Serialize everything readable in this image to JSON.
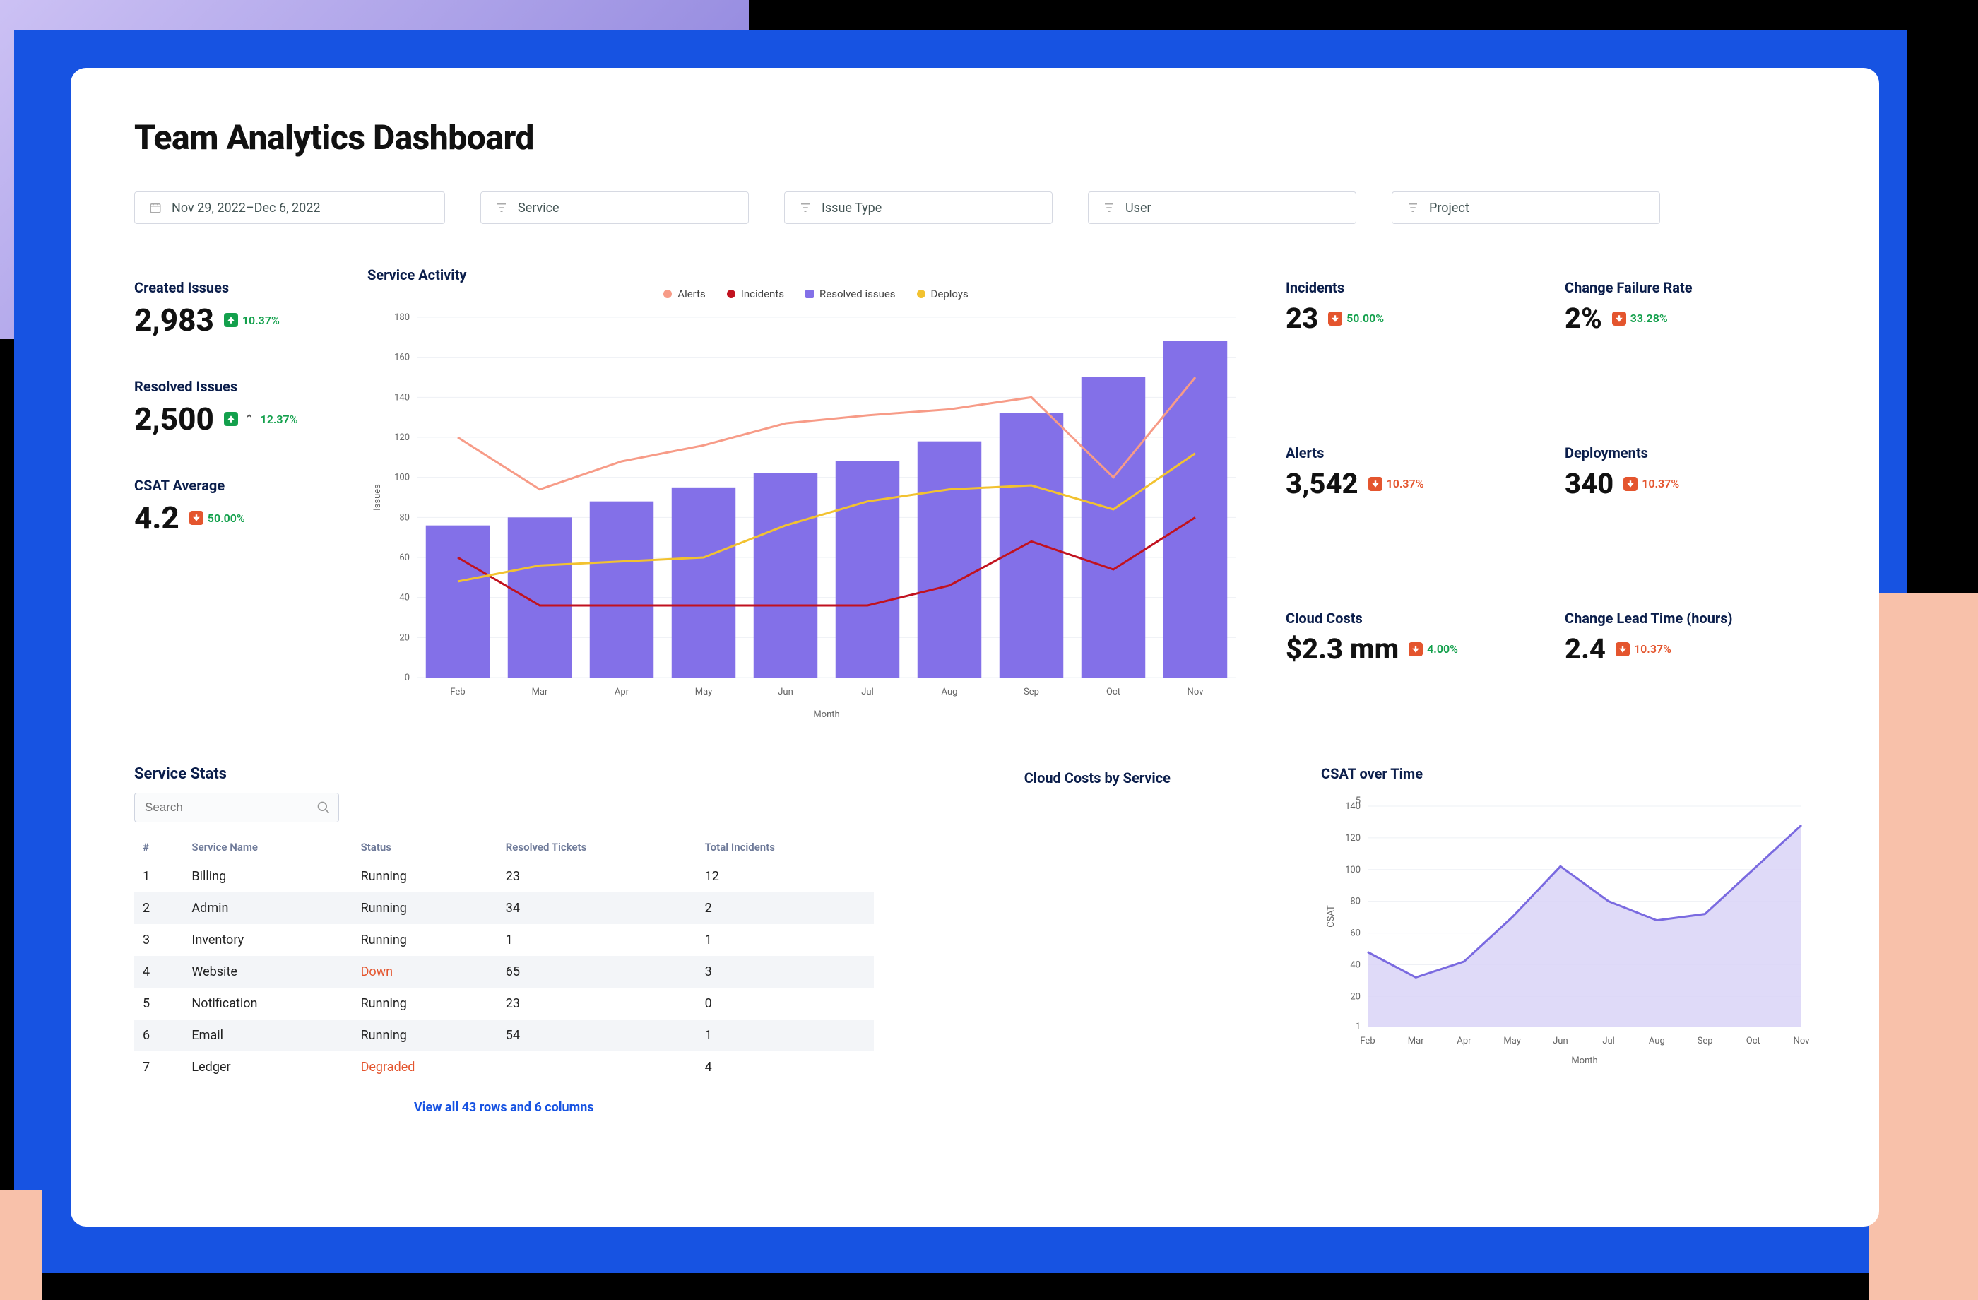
{
  "title": "Team Analytics Dashboard",
  "filters": {
    "date_range": "Nov 29, 2022–Dec 6, 2022",
    "service": "Service",
    "issue_type": "Issue Type",
    "user": "User",
    "project": "Project"
  },
  "kpi_left": {
    "created": {
      "label": "Created Issues",
      "value": "2,983",
      "delta": "10.37%",
      "dir": "up",
      "tone": "green"
    },
    "resolved": {
      "label": "Resolved Issues",
      "value": "2,500",
      "delta": "12.37%",
      "dir": "up",
      "tone": "green",
      "show_caret": true
    },
    "csat": {
      "label": "CSAT Average",
      "value": "4.2",
      "delta": "50.00%",
      "dir": "down",
      "tone": "orange"
    }
  },
  "kpi_right": {
    "incidents": {
      "label": "Incidents",
      "value": "23",
      "delta": "50.00%",
      "dir": "down",
      "tone": "orange"
    },
    "cfr": {
      "label": "Change Failure Rate",
      "value": "2%",
      "delta": "33.28%",
      "dir": "down",
      "tone": "orange"
    },
    "alerts": {
      "label": "Alerts",
      "value": "3,542",
      "delta": "10.37%",
      "dir": "down",
      "tone": "orange"
    },
    "deployments": {
      "label": "Deployments",
      "value": "340",
      "delta": "10.37%",
      "dir": "down",
      "tone": "orange"
    },
    "cloud_costs": {
      "label": "Cloud Costs",
      "value": "$2.3 mm",
      "delta": "4.00%",
      "dir": "down",
      "tone": "orange",
      "delta_color": "green"
    },
    "lead_time": {
      "label": "Change Lead Time (hours)",
      "value": "2.4",
      "delta": "10.37%",
      "dir": "down",
      "tone": "orange"
    }
  },
  "service_activity": {
    "title": "Service Activity",
    "xlabel": "Month",
    "ylabel": "Issues",
    "legend": {
      "alerts": "Alerts",
      "incidents": "Incidents",
      "resolved": "Resolved issues",
      "deploys": "Deploys"
    }
  },
  "cloud_costs_section": {
    "title": "Cloud Costs by Service"
  },
  "csat_chart": {
    "title": "CSAT over Time",
    "xlabel": "Month",
    "ylabel": "CSAT"
  },
  "stats": {
    "title": "Service Stats",
    "search_placeholder": "Search",
    "columns": {
      "idx": "#",
      "name": "Service Name",
      "status": "Status",
      "resolved": "Resolved Tickets",
      "total": "Total Incidents"
    },
    "rows": [
      {
        "idx": "1",
        "name": "Billing",
        "status": "Running",
        "resolved": "23",
        "total": "12"
      },
      {
        "idx": "2",
        "name": "Admin",
        "status": "Running",
        "resolved": "34",
        "total": "2"
      },
      {
        "idx": "3",
        "name": "Inventory",
        "status": "Running",
        "resolved": "1",
        "total": "1"
      },
      {
        "idx": "4",
        "name": "Website",
        "status": "Down",
        "resolved": "65",
        "total": "3"
      },
      {
        "idx": "5",
        "name": "Notification",
        "status": "Running",
        "resolved": "23",
        "total": "0"
      },
      {
        "idx": "6",
        "name": "Email",
        "status": "Running",
        "resolved": "54",
        "total": "1"
      },
      {
        "idx": "7",
        "name": "Ledger",
        "status": "Degraded",
        "resolved": "",
        "total": "4"
      }
    ],
    "view_all": "View all 43 rows and 6 columns"
  },
  "colors": {
    "bar": "#8370e8",
    "alerts": "#f79b87",
    "incidents": "#c1121f",
    "deploys": "#f2c230",
    "csat_fill": "#d9d4f7",
    "csat_line": "#7a6ae0"
  },
  "chart_data": [
    {
      "id": "service_activity",
      "type": "bar+line",
      "title": "Service Activity",
      "xlabel": "Month",
      "ylabel": "Issues",
      "ylim": [
        0,
        180
      ],
      "yticks": [
        0,
        20,
        40,
        60,
        80,
        100,
        120,
        140,
        160,
        180
      ],
      "categories": [
        "Feb",
        "Mar",
        "Apr",
        "May",
        "Jun",
        "Jul",
        "Aug",
        "Sep",
        "Oct",
        "Nov"
      ],
      "bars": {
        "name": "Resolved issues",
        "values": [
          76,
          80,
          88,
          95,
          102,
          108,
          118,
          132,
          150,
          168
        ]
      },
      "lines": [
        {
          "name": "Alerts",
          "values": [
            120,
            94,
            108,
            116,
            127,
            131,
            134,
            140,
            100,
            150
          ]
        },
        {
          "name": "Incidents",
          "values": [
            60,
            36,
            36,
            36,
            36,
            36,
            46,
            68,
            54,
            80
          ]
        },
        {
          "name": "Deploys",
          "values": [
            48,
            56,
            58,
            60,
            76,
            88,
            94,
            96,
            84,
            112
          ]
        }
      ]
    },
    {
      "id": "csat_over_time",
      "type": "area",
      "title": "CSAT over Time",
      "xlabel": "Month",
      "ylabel": "CSAT",
      "yticks": [
        1,
        20,
        40,
        60,
        80,
        100,
        120,
        140
      ],
      "yextra": 5,
      "categories": [
        "Feb",
        "Mar",
        "Apr",
        "May",
        "Jun",
        "Jul",
        "Aug",
        "Sep",
        "Oct",
        "Nov"
      ],
      "values": [
        48,
        32,
        42,
        70,
        102,
        80,
        68,
        72,
        100,
        128
      ]
    }
  ]
}
